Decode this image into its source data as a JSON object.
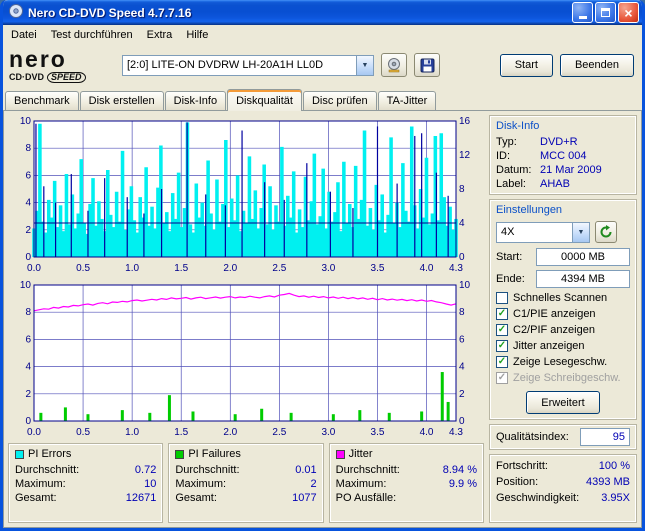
{
  "window": {
    "title": "Nero CD-DVD Speed 4.7.7.16"
  },
  "icons": {
    "close": "×",
    "dropdown": "▼",
    "check": "✓"
  },
  "menu": {
    "items": [
      "Datei",
      "Test durchführen",
      "Extra",
      "Hilfe"
    ]
  },
  "toolbar": {
    "logo": {
      "brand": "nero",
      "product": "CD·DVD",
      "speed": "SPEED"
    },
    "device": "[2:0]  LITE-ON DVDRW LH-20A1H LL0D",
    "start": "Start",
    "quit": "Beenden"
  },
  "tabs": {
    "items": [
      "Benchmark",
      "Disk erstellen",
      "Disk-Info",
      "Diskqualität",
      "Disc prüfen",
      "TA-Jitter"
    ],
    "active_index": 3
  },
  "disk_info": {
    "title": "Disk-Info",
    "rows": [
      {
        "label": "Typ:",
        "value": "DVD+R"
      },
      {
        "label": "ID:",
        "value": "MCC 004"
      },
      {
        "label": "Datum:",
        "value": "21 Mar 2009"
      },
      {
        "label": "Label:",
        "value": "AHAB"
      }
    ]
  },
  "settings": {
    "title": "Einstellungen",
    "speed_value": "4X",
    "start_label": "Start:",
    "start_value": "0000 MB",
    "end_label": "Ende:",
    "end_value": "4394 MB",
    "checkboxes": [
      {
        "label": "Schnelles Scannen",
        "checked": false,
        "disabled": false
      },
      {
        "label": "C1/PIE anzeigen",
        "checked": true,
        "disabled": false
      },
      {
        "label": "C2/PIF anzeigen",
        "checked": true,
        "disabled": false
      },
      {
        "label": "Jitter anzeigen",
        "checked": true,
        "disabled": false
      },
      {
        "label": "Zeige Lesegeschw.",
        "checked": true,
        "disabled": false
      },
      {
        "label": "Zeige Schreibgeschw.",
        "checked": true,
        "disabled": true
      }
    ],
    "advanced": "Erweitert"
  },
  "quality": {
    "label": "Qualitätsindex:",
    "value": "95"
  },
  "progress": {
    "rows": [
      {
        "label": "Fortschritt:",
        "value": "100 %"
      },
      {
        "label": "Position:",
        "value": "4393 MB"
      },
      {
        "label": "Geschwindigkeit:",
        "value": "3.95X"
      }
    ]
  },
  "stats": [
    {
      "title": "PI Errors",
      "color": "#00F0F0",
      "rows": [
        {
          "label": "Durchschnitt:",
          "value": "0.72"
        },
        {
          "label": "Maximum:",
          "value": "10"
        },
        {
          "label": "Gesamt:",
          "value": "12671"
        }
      ]
    },
    {
      "title": "PI Failures",
      "color": "#00CC00",
      "rows": [
        {
          "label": "Durchschnitt:",
          "value": "0.01"
        },
        {
          "label": "Maximum:",
          "value": "2"
        },
        {
          "label": "Gesamt:",
          "value": "1077"
        }
      ]
    },
    {
      "title": "Jitter",
      "color": "#FF00FF",
      "rows": [
        {
          "label": "Durchschnitt:",
          "value": "8.94 %"
        },
        {
          "label": "Maximum:",
          "value": "9.9 %"
        },
        {
          "label": "PO Ausfälle:",
          "value": ""
        }
      ]
    }
  ],
  "chart_data": [
    {
      "name": "pi-errors",
      "type": "area",
      "x_range": [
        0,
        4.3
      ],
      "x_ticks": [
        "0.0",
        "0.5",
        "1.0",
        "1.5",
        "2.0",
        "2.5",
        "3.0",
        "3.5",
        "4.0",
        "4.3"
      ],
      "y_left": {
        "range": [
          0,
          10
        ],
        "ticks": [
          0,
          2,
          4,
          6,
          8,
          10
        ]
      },
      "y_right": {
        "range": [
          0,
          16
        ],
        "ticks": [
          0,
          4,
          8,
          12,
          16
        ]
      },
      "series": [
        {
          "name": "PI Errors",
          "type": "spikes",
          "color": "#00F0F0",
          "values": [
            2.1,
            3.4,
            9.8,
            2.6,
            1.8,
            4.2,
            2.9,
            5.6,
            2.2,
            3.8,
            1.9,
            6.1,
            2.4,
            4.6,
            2.1,
            3.2,
            7.2,
            2.5,
            1.7,
            3.9,
            5.8,
            2.3,
            4.1,
            2.8,
            1.9,
            6.4,
            3.1,
            2.2,
            4.8,
            2.6,
            7.8,
            2.0,
            3.5,
            5.2,
            2.7,
            1.8,
            4.4,
            2.9,
            6.6,
            2.3,
            3.7,
            2.1,
            5.1,
            8.2,
            2.5,
            3.3,
            1.9,
            4.7,
            2.8,
            6.2,
            2.2,
            3.6,
            9.9,
            2.4,
            1.8,
            5.4,
            2.9,
            4.0,
            2.3,
            7.1,
            3.2,
            2.0,
            5.7,
            2.6,
            3.9,
            8.6,
            2.2,
            4.3,
            2.7,
            6.0,
            1.9,
            3.4,
            2.5,
            7.4,
            2.8,
            4.9,
            2.1,
            3.6,
            6.8,
            2.4,
            5.2,
            2.0,
            3.8,
            2.6,
            8.1,
            2.3,
            4.5,
            2.9,
            6.3,
            1.8,
            3.5,
            2.2,
            5.9,
            2.7,
            4.1,
            7.6,
            2.4,
            3.0,
            6.5,
            2.1,
            4.8,
            2.6,
            3.3,
            5.5,
            1.9,
            7.0,
            2.5,
            3.9,
            2.2,
            6.7,
            2.8,
            4.2,
            9.3,
            2.3,
            3.6,
            2.0,
            5.3,
            2.7,
            4.6,
            1.8,
            3.1,
            8.8,
            2.5,
            4.0,
            2.2,
            6.9,
            3.4,
            2.6,
            9.6,
            3.8,
            2.1,
            5.0,
            2.9,
            7.3,
            2.4,
            3.2,
            8.9,
            2.7,
            9.1,
            4.4,
            2.3,
            3.7,
            2.0,
            2.8
          ]
        },
        {
          "name": "PI Errors Spitzen",
          "type": "bars",
          "color": "#0000A0",
          "barw": 1.2,
          "points": [
            [
              0.02,
              9.8
            ],
            [
              0.1,
              5.2
            ],
            [
              0.22,
              4.0
            ],
            [
              0.38,
              6.1
            ],
            [
              0.55,
              3.4
            ],
            [
              0.72,
              5.8
            ],
            [
              0.95,
              4.4
            ],
            [
              1.12,
              3.2
            ],
            [
              1.3,
              5.0
            ],
            [
              1.56,
              9.9
            ],
            [
              1.75,
              4.6
            ],
            [
              1.95,
              3.8
            ],
            [
              2.12,
              9.3
            ],
            [
              2.35,
              5.5
            ],
            [
              2.55,
              4.2
            ],
            [
              2.78,
              6.9
            ],
            [
              3.02,
              4.8
            ],
            [
              3.25,
              3.6
            ],
            [
              3.5,
              9.6
            ],
            [
              3.7,
              5.4
            ],
            [
              3.88,
              8.9
            ],
            [
              3.95,
              9.1
            ],
            [
              4.1,
              6.2
            ],
            [
              4.22,
              4.5
            ]
          ]
        },
        {
          "name": "Lesegeschwindigkeit 4X",
          "type": "hline",
          "y": 2.5,
          "color": "#00008B"
        }
      ]
    },
    {
      "name": "pif-jitter",
      "type": "bar+line",
      "x_range": [
        0,
        4.3
      ],
      "x_ticks": [
        "0.0",
        "0.5",
        "1.0",
        "1.5",
        "2.0",
        "2.5",
        "3.0",
        "3.5",
        "4.0",
        "4.3"
      ],
      "y_left": {
        "range": [
          0,
          10
        ],
        "ticks": [
          0,
          2,
          4,
          6,
          8,
          10
        ]
      },
      "y_right": {
        "range": [
          0,
          10
        ],
        "ticks": [
          0,
          2,
          4,
          6,
          8,
          10
        ]
      },
      "series": [
        {
          "name": "PI Failures",
          "type": "bars",
          "color": "#00CC00",
          "barw": 3,
          "points": [
            [
              0.07,
              0.6
            ],
            [
              0.32,
              1.0
            ],
            [
              0.55,
              0.5
            ],
            [
              0.9,
              0.8
            ],
            [
              1.18,
              0.6
            ],
            [
              1.38,
              1.9
            ],
            [
              1.62,
              0.7
            ],
            [
              2.05,
              0.5
            ],
            [
              2.32,
              0.9
            ],
            [
              2.62,
              0.6
            ],
            [
              3.05,
              0.5
            ],
            [
              3.32,
              0.8
            ],
            [
              3.62,
              0.6
            ],
            [
              3.95,
              0.7
            ],
            [
              4.16,
              3.6
            ],
            [
              4.22,
              1.4
            ]
          ]
        },
        {
          "name": "Jitter",
          "type": "line",
          "color": "#FF00FF",
          "values": [
            8.1,
            8.18,
            8.25,
            8.22,
            8.35,
            8.3,
            8.42,
            8.38,
            8.5,
            8.46,
            8.55,
            8.6,
            8.52,
            8.65,
            8.7,
            8.62,
            8.75,
            8.72,
            8.8,
            8.76,
            8.85,
            8.9,
            8.82,
            8.88,
            8.95,
            8.9,
            9.0,
            8.94,
            9.05,
            8.98,
            9.02,
            9.08,
            8.96,
            9.05,
            9.1,
            9.0,
            9.06,
            9.12,
            9.04,
            9.1,
            9.15,
            9.05,
            9.12,
            9.08,
            9.18,
            9.1,
            9.05,
            9.15,
            9.2,
            9.12,
            9.25,
            9.3,
            9.38,
            9.25,
            9.15,
            9.2,
            9.1,
            9.18,
            9.08,
            9.15,
            9.05,
            9.12,
            9.02,
            9.1,
            9.0,
            9.08,
            8.98,
            9.05,
            8.95,
            9.02,
            8.92,
            9.0,
            8.9,
            8.96,
            8.88,
            8.94,
            8.85,
            8.92,
            8.82,
            8.9,
            8.8,
            8.86,
            8.76,
            8.7,
            8.6,
            8.52,
            8.62
          ]
        }
      ]
    }
  ]
}
